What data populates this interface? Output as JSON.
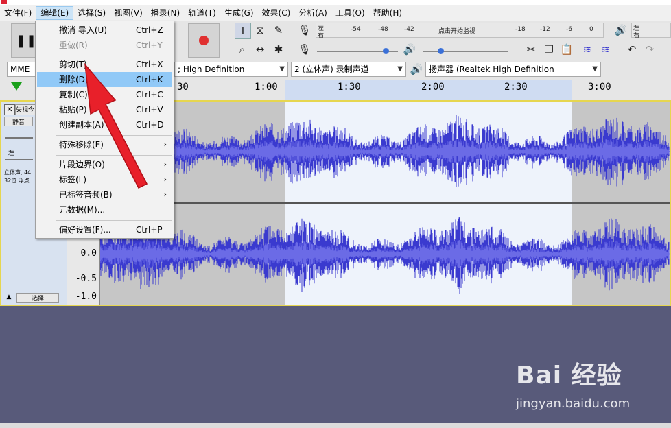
{
  "menubar": {
    "items": [
      {
        "label": "文件(F)"
      },
      {
        "label": "编辑(E)"
      },
      {
        "label": "选择(S)"
      },
      {
        "label": "视图(V)"
      },
      {
        "label": "播录(N)"
      },
      {
        "label": "轨道(T)"
      },
      {
        "label": "生成(G)"
      },
      {
        "label": "效果(C)"
      },
      {
        "label": "分析(A)"
      },
      {
        "label": "工具(O)"
      },
      {
        "label": "帮助(H)"
      }
    ]
  },
  "edit_menu": {
    "items": [
      {
        "label": "撤消 导入(U)",
        "shortcut": "Ctrl+Z"
      },
      {
        "label": "重做(R)",
        "shortcut": "Ctrl+Y"
      },
      {
        "label": "剪切(T)",
        "shortcut": "Ctrl+X"
      },
      {
        "label": "删除(D)",
        "shortcut": "Ctrl+K"
      },
      {
        "label": "复制(C)",
        "shortcut": "Ctrl+C"
      },
      {
        "label": "粘贴(P)",
        "shortcut": "Ctrl+V"
      },
      {
        "label": "创建副本(A)",
        "shortcut": "Ctrl+D"
      },
      {
        "label": "特殊移除(E)",
        "submenu": "›"
      },
      {
        "label": "片段边界(O)",
        "submenu": "›"
      },
      {
        "label": "标签(L)",
        "submenu": "›"
      },
      {
        "label": "已标签音频(B)",
        "submenu": "›"
      },
      {
        "label": "元数据(M)..."
      },
      {
        "label": "偏好设置(F)...",
        "shortcut": "Ctrl+P"
      }
    ]
  },
  "meters": {
    "record_side_top": "左",
    "record_side_bottom": "右",
    "record_scale": [
      "-54",
      "-48",
      "-42",
      "点击开始监视",
      "-18",
      "-12",
      "-6",
      "0"
    ],
    "play_side_top": "左",
    "play_side_bottom": "右"
  },
  "devices": {
    "host": "MME",
    "record_device": "; High Definition",
    "channels": "2 (立体声) 录制声道",
    "playback_device": "扬声器 (Realtek High Definition"
  },
  "timeline": {
    "ticks": [
      "30",
      "1:00",
      "1:30",
      "2:00",
      "2:30",
      "3:00"
    ]
  },
  "track": {
    "name": "失视今",
    "mute_label": "静音",
    "pan_left": "左",
    "info_line1": "立体声, 44",
    "info_line2": "32位 浮点",
    "select_label": "选择",
    "scale_labels": [
      "0.0",
      "-0.5",
      "-1.0"
    ]
  },
  "watermark": {
    "brand": "Bai  经验",
    "url": "jingyan.baidu.com"
  },
  "colors": {
    "waveform": "#3a3acf",
    "waveform_rms": "#6b6be6",
    "selection": "#eef3fb",
    "menu_highlight": "#91c9f7",
    "arrow": "#e8202a",
    "record": "#e03030"
  }
}
